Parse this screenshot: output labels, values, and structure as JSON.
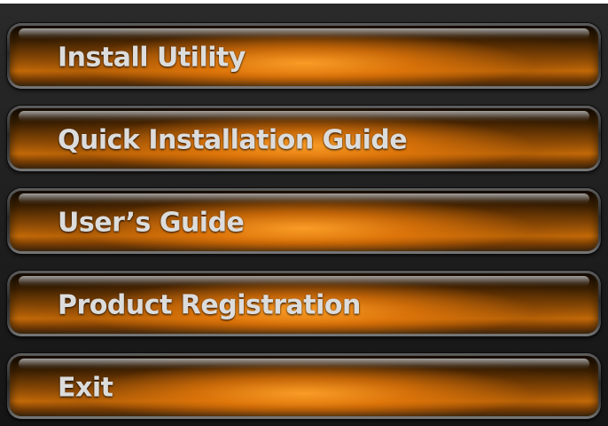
{
  "menu": {
    "items": [
      {
        "label": "Install Utility"
      },
      {
        "label": "Quick Installation Guide"
      },
      {
        "label": "User’s Guide"
      },
      {
        "label": "Product Registration"
      },
      {
        "label": "Exit"
      }
    ]
  },
  "colors": {
    "accent": "#e88a10",
    "panel_background": "#222222",
    "label_text": "#dcdcdc"
  }
}
